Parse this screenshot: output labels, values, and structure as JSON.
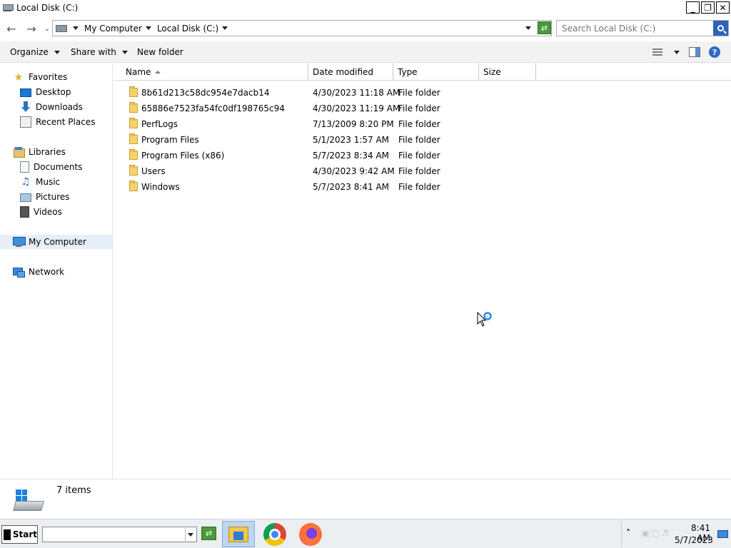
{
  "window": {
    "title": "Local Disk (C:)",
    "controls": {
      "minimize": "_",
      "restore": "❐",
      "close": "✕"
    }
  },
  "address": {
    "breadcrumbs": [
      "My Computer",
      "Local Disk (C:)"
    ],
    "search_placeholder": "Search Local Disk (C:)"
  },
  "toolbar": {
    "organize": "Organize",
    "share_with": "Share with",
    "new_folder": "New folder"
  },
  "nav": {
    "favorites": {
      "label": "Favorites",
      "items": [
        {
          "label": "Desktop",
          "icon": "desktop-icon"
        },
        {
          "label": "Downloads",
          "icon": "downloads-icon"
        },
        {
          "label": "Recent Places",
          "icon": "recent-places-icon"
        }
      ]
    },
    "libraries": {
      "label": "Libraries",
      "items": [
        {
          "label": "Documents",
          "icon": "documents-icon"
        },
        {
          "label": "Music",
          "icon": "music-icon"
        },
        {
          "label": "Pictures",
          "icon": "pictures-icon"
        },
        {
          "label": "Videos",
          "icon": "videos-icon"
        }
      ]
    },
    "computer": {
      "label": "My Computer",
      "selected": true
    },
    "network": {
      "label": "Network"
    }
  },
  "columns": {
    "name": "Name",
    "date_modified": "Date modified",
    "type": "Type",
    "size": "Size",
    "sorted_by": "name"
  },
  "files": [
    {
      "name": "8b61d213c58dc954e7dacb14",
      "date": "4/30/2023 11:18 AM",
      "type": "File folder",
      "size": ""
    },
    {
      "name": "65886e7523fa54fc0df198765c94",
      "date": "4/30/2023 11:19 AM",
      "type": "File folder",
      "size": ""
    },
    {
      "name": "PerfLogs",
      "date": "7/13/2009 8:20 PM",
      "type": "File folder",
      "size": ""
    },
    {
      "name": "Program Files",
      "date": "5/1/2023 1:57 AM",
      "type": "File folder",
      "size": ""
    },
    {
      "name": "Program Files (x86)",
      "date": "5/7/2023 8:34 AM",
      "type": "File folder",
      "size": ""
    },
    {
      "name": "Users",
      "date": "4/30/2023 9:42 AM",
      "type": "File folder",
      "size": ""
    },
    {
      "name": "Windows",
      "date": "5/7/2023 8:41 AM",
      "type": "File folder",
      "size": ""
    }
  ],
  "status": {
    "item_count": "7 items"
  },
  "taskbar": {
    "start": "Start",
    "apps": [
      "file-explorer-icon",
      "chrome-icon",
      "firefox-icon"
    ],
    "clock_time": "8:41 AM",
    "clock_date": "5/7/2023"
  },
  "colors": {
    "selection": "#e5eef9",
    "accent": "#2d64b8",
    "folder": "#f5d36b",
    "toolbar_bg": "#f2f2f2",
    "taskbar_bg": "#eceff2"
  }
}
